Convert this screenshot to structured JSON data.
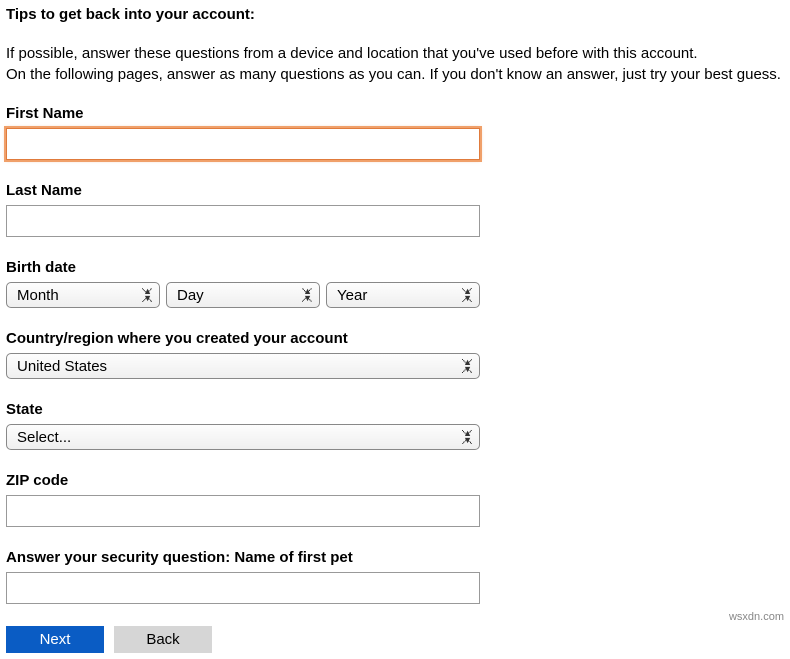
{
  "heading": "Tips to get back into your account:",
  "tips_line1": "If possible, answer these questions from a device and location that you've used before with this account.",
  "tips_line2": "On the following pages, answer as many questions as you can. If you don't know an answer, just try your best guess.",
  "labels": {
    "first_name": "First Name",
    "last_name": "Last Name",
    "birth_date": "Birth date",
    "country": "Country/region where you created your account",
    "state": "State",
    "zip": "ZIP code",
    "security": "Answer your security question: Name of first pet"
  },
  "values": {
    "first_name": "",
    "last_name": "",
    "zip": "",
    "security": ""
  },
  "selects": {
    "month": "Month",
    "day": "Day",
    "year": "Year",
    "country": "United States",
    "state": "Select..."
  },
  "buttons": {
    "next": "Next",
    "back": "Back"
  },
  "watermark": "wsxdn.com"
}
